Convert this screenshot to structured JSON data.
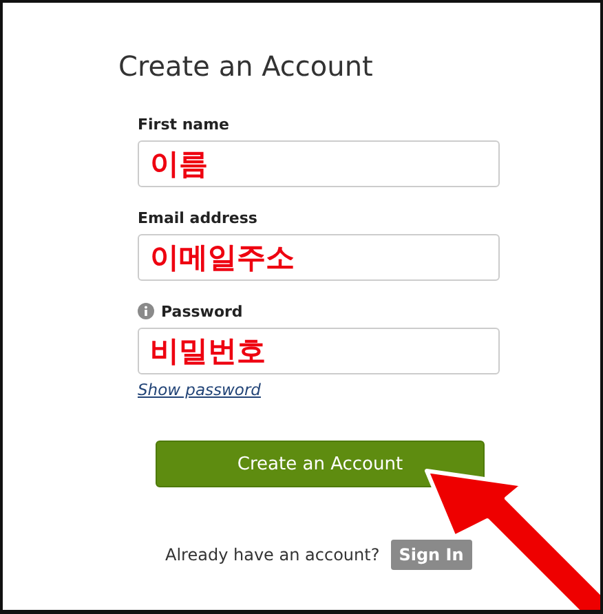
{
  "title": "Create an Account",
  "fields": [
    {
      "label": "First name",
      "value": "이름",
      "info": false
    },
    {
      "label": "Email address",
      "value": "이메일주소",
      "info": false
    },
    {
      "label": "Password",
      "value": "비밀번호",
      "info": true
    }
  ],
  "show_password": "Show password",
  "submit_button": "Create an Account",
  "signin_prompt": "Already have an account?",
  "signin_button": "Sign In"
}
